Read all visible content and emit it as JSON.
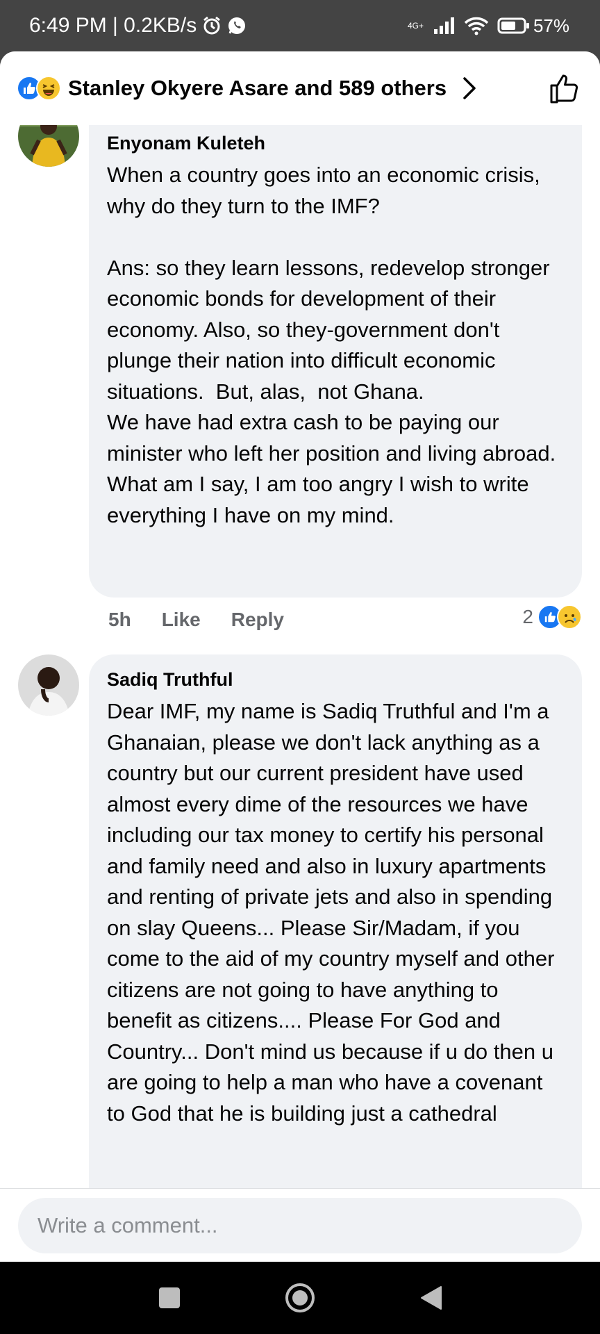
{
  "status_bar": {
    "time_speed": "6:49 PM | 0.2KB/s",
    "network": "4G+",
    "battery": "57%"
  },
  "reactions_header": {
    "text": "Stanley Okyere Asare and 589 others"
  },
  "comments": [
    {
      "author": "Enyonam Kuleteh",
      "text": "When a country goes into an economic crisis, why do they turn to the IMF?\n\nAns: so they learn lessons, redevelop stronger economic bonds for development of their economy. Also, so they-government don't plunge their nation into difficult economic situations.  But, alas,  not Ghana.\nWe have had extra cash to be paying our minister who left her position and living abroad.\nWhat am I say, I am too angry I wish to write everything I have on my mind.",
      "time": "5h",
      "like_label": "Like",
      "reply_label": "Reply",
      "reaction_count": "2"
    },
    {
      "author": "Sadiq Truthful",
      "text": "Dear IMF, my name is Sadiq Truthful and I'm a Ghanaian, please we don't lack anything as a country but our current president have used almost every dime of the resources we have including our tax money to certify his personal and family need and also in luxury apartments and renting of private jets and also in spending on slay Queens... Please Sir/Madam, if you come to the aid of my country myself and other citizens are not going to have anything to benefit as citizens.... Please For God and Country... Don't mind us because if u do then u are going to help a man who have a covenant to God that he is building just a cathedral"
    }
  ],
  "composer": {
    "placeholder": "Write a comment..."
  },
  "colors": {
    "like_blue": "#1877f2",
    "bubble_bg": "#f0f2f5",
    "meta_gray": "#65676b",
    "status_bg": "#444444"
  }
}
